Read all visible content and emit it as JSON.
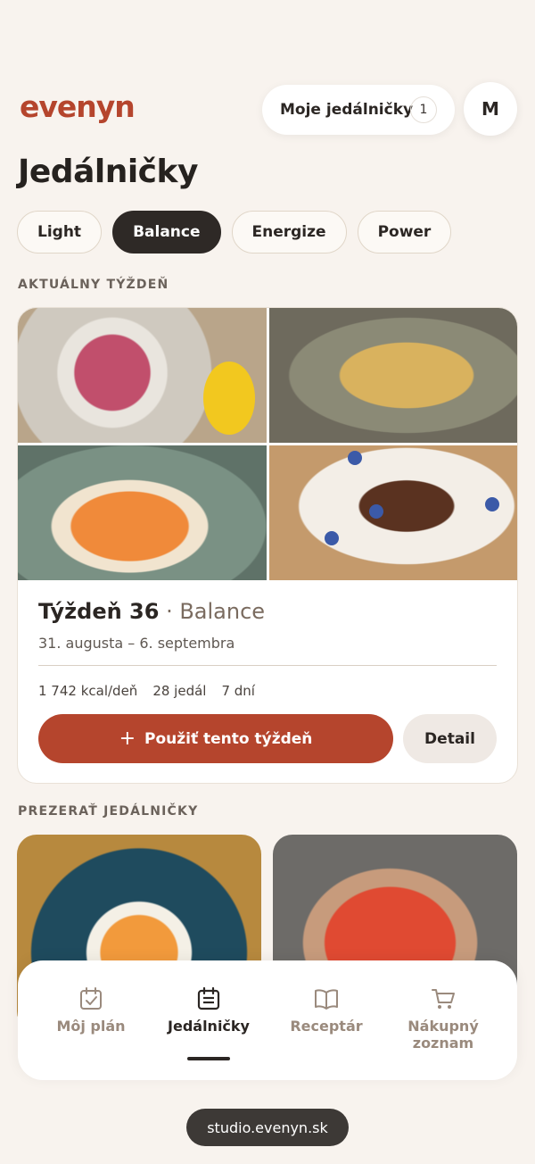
{
  "header": {
    "logo": "evenyn",
    "plans_label": "Moje jedálničky",
    "plans_count": "1",
    "avatar_initial": "M"
  },
  "page_title": "Jedálničky",
  "filters": [
    {
      "label": "Light",
      "active": false
    },
    {
      "label": "Balance",
      "active": true
    },
    {
      "label": "Energize",
      "active": false
    },
    {
      "label": "Power",
      "active": false
    }
  ],
  "current_week": {
    "section_label": "AKTUÁLNY TÝŽDEŇ",
    "title": "Týždeň 36",
    "separator": " · ",
    "plan_name": "Balance",
    "date_range": "31. augusta – 6. septembra",
    "calories": "1 742 kcal/deň",
    "meals": "28 jedál",
    "days": "7 dní",
    "use_button": "Použiť tento týždeň",
    "detail_button": "Detail"
  },
  "browse": {
    "section_label": "PREZERAŤ JEDÁLNIČKY"
  },
  "bottom_nav": [
    {
      "label": "Môj plán",
      "icon": "calendar-check-icon",
      "active": false
    },
    {
      "label": "Jedálničky",
      "icon": "calendar-list-icon",
      "active": true
    },
    {
      "label": "Receptár",
      "icon": "book-icon",
      "active": false
    },
    {
      "label": "Nákupný zoznam",
      "icon": "cart-icon",
      "active": false
    }
  ],
  "url": "studio.evenyn.sk",
  "colors": {
    "brand": "#b5452d",
    "dark": "#2e2926",
    "background": "#f8f3ee"
  }
}
